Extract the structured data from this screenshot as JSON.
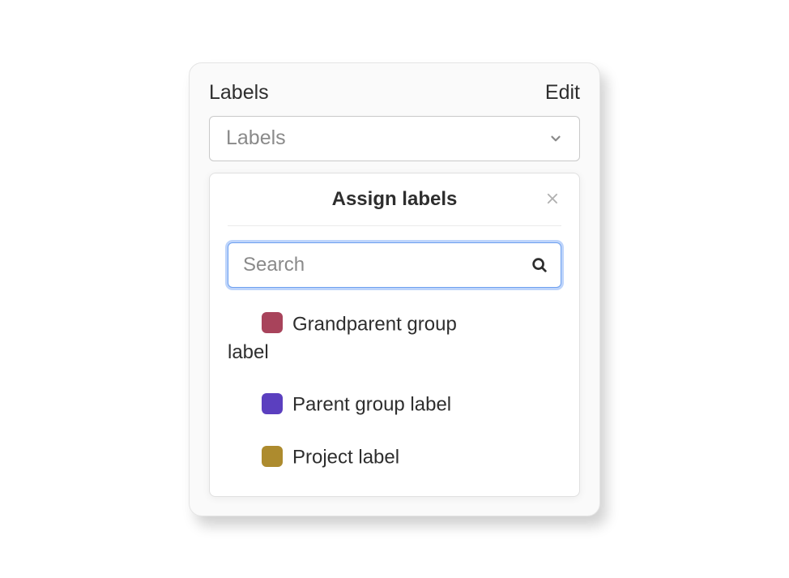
{
  "panel": {
    "title": "Labels",
    "edit": "Edit"
  },
  "dropdown": {
    "label": "Labels"
  },
  "popover": {
    "title": "Assign labels",
    "search_placeholder": "Search"
  },
  "labels": [
    {
      "name": "Grandparent group label",
      "color": "#A8435B",
      "wraps": true
    },
    {
      "name": "Parent group label",
      "color": "#5B3FBF",
      "wraps": false
    },
    {
      "name": "Project label",
      "color": "#AD8B2E",
      "wraps": false
    }
  ]
}
